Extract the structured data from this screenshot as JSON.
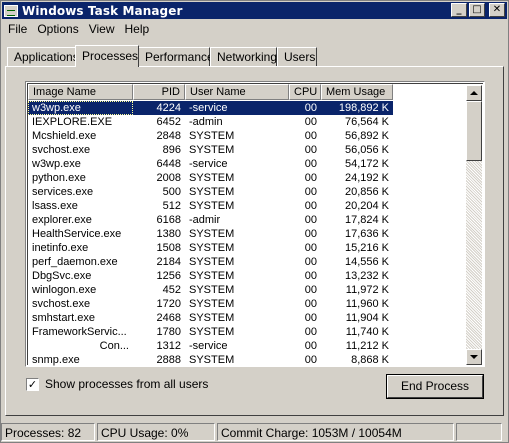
{
  "window": {
    "title": "Windows Task Manager"
  },
  "title_buttons": {
    "minimize": "_",
    "maximize": "□",
    "close": "✕"
  },
  "menu": [
    "File",
    "Options",
    "View",
    "Help"
  ],
  "tabs": [
    "Applications",
    "Processes",
    "Performance",
    "Networking",
    "Users"
  ],
  "active_tab": "Processes",
  "columns": [
    "Image Name",
    "PID",
    "User Name",
    "CPU",
    "Mem Usage"
  ],
  "rows": [
    {
      "name": "w3wp.exe",
      "pid": "4224",
      "user": "-service",
      "cpu": "00",
      "mem": "198,892 K"
    },
    {
      "name": "IEXPLORE.EXE",
      "pid": "6452",
      "user": "-admin",
      "cpu": "00",
      "mem": "76,564 K"
    },
    {
      "name": "Mcshield.exe",
      "pid": "2848",
      "user": "SYSTEM",
      "cpu": "00",
      "mem": "56,892 K"
    },
    {
      "name": "svchost.exe",
      "pid": "896",
      "user": "SYSTEM",
      "cpu": "00",
      "mem": "56,056 K"
    },
    {
      "name": "w3wp.exe",
      "pid": "6448",
      "user": "-service",
      "cpu": "00",
      "mem": "54,172 K"
    },
    {
      "name": "python.exe",
      "pid": "2008",
      "user": "SYSTEM",
      "cpu": "00",
      "mem": "24,192 K"
    },
    {
      "name": "services.exe",
      "pid": "500",
      "user": "SYSTEM",
      "cpu": "00",
      "mem": "20,856 K"
    },
    {
      "name": "lsass.exe",
      "pid": "512",
      "user": "SYSTEM",
      "cpu": "00",
      "mem": "20,204 K"
    },
    {
      "name": "explorer.exe",
      "pid": "6168",
      "user": "-admir",
      "cpu": "00",
      "mem": "17,824 K"
    },
    {
      "name": "HealthService.exe",
      "pid": "1380",
      "user": "SYSTEM",
      "cpu": "00",
      "mem": "17,636 K"
    },
    {
      "name": "inetinfo.exe",
      "pid": "1508",
      "user": "SYSTEM",
      "cpu": "00",
      "mem": "15,216 K"
    },
    {
      "name": "perf_daemon.exe",
      "pid": "2184",
      "user": "SYSTEM",
      "cpu": "00",
      "mem": "14,556 K"
    },
    {
      "name": "DbgSvc.exe",
      "pid": "1256",
      "user": "SYSTEM",
      "cpu": "00",
      "mem": "13,232 K"
    },
    {
      "name": "winlogon.exe",
      "pid": "452",
      "user": "SYSTEM",
      "cpu": "00",
      "mem": "11,972 K"
    },
    {
      "name": "svchost.exe",
      "pid": "1720",
      "user": "SYSTEM",
      "cpu": "00",
      "mem": "11,960 K"
    },
    {
      "name": "smhstart.exe",
      "pid": "2468",
      "user": "SYSTEM",
      "cpu": "00",
      "mem": "11,904 K"
    },
    {
      "name": "FrameworkServic...",
      "pid": "1780",
      "user": "SYSTEM",
      "cpu": "00",
      "mem": "11,740 K"
    },
    {
      "name": "Con...",
      "pid": "1312",
      "user": "-service",
      "cpu": "00",
      "mem": "11,212 K"
    },
    {
      "name": "snmp.exe",
      "pid": "2888",
      "user": "SYSTEM",
      "cpu": "00",
      "mem": "8,868 K"
    }
  ],
  "selected_row": 0,
  "show_all_users": {
    "label": "Show processes from all users",
    "checked": true,
    "mark": "✓"
  },
  "end_process_label": "End Process",
  "status": {
    "processes": "Processes: 82",
    "cpu": "CPU Usage: 0%",
    "commit": "Commit Charge: 1053M / 10054M"
  },
  "colors": {
    "titlebar": "#0a246a",
    "face": "#d4d0c8",
    "selection": "#0a246a"
  },
  "icons": {
    "app": "task-manager-icon",
    "check": "checkmark-icon"
  }
}
